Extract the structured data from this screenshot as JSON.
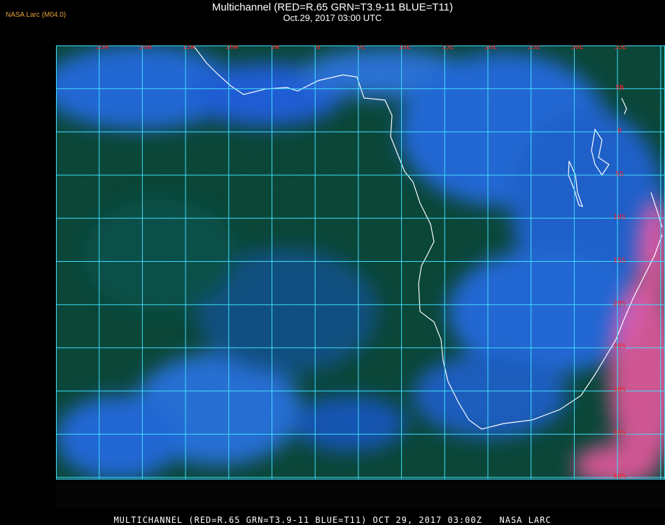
{
  "header": {
    "brand": "NASA Larc (M04.0)",
    "title": "Multichannel (RED=R.65 GRN=T3.9-11 BLUE=T11)",
    "datetime": "Oct.29, 2017 03:00 UTC"
  },
  "map": {
    "lon_labels": [
      "25W",
      "20W",
      "15W",
      "10W",
      "5W",
      "0",
      "5E",
      "10E",
      "15E",
      "20E",
      "25E",
      "30E",
      "35E"
    ],
    "lat_labels": [
      "5N",
      "0",
      "5S",
      "10S",
      "15S",
      "20S",
      "25S",
      "30S",
      "35S",
      "40S"
    ],
    "grid_color": "#40e0ff",
    "label_color": "#ff2020",
    "coast_color": "#ffffff",
    "ocean_color": "#0d3b22",
    "cloud_color": "#2f6bff",
    "land_heat_color": "#ff5aa8"
  },
  "footer": {
    "caption": "MULTICHANNEL (RED=R.65 GRN=T3.9-11 BLUE=T11) OCT 29, 2017 03:00Z   NASA LARC"
  }
}
